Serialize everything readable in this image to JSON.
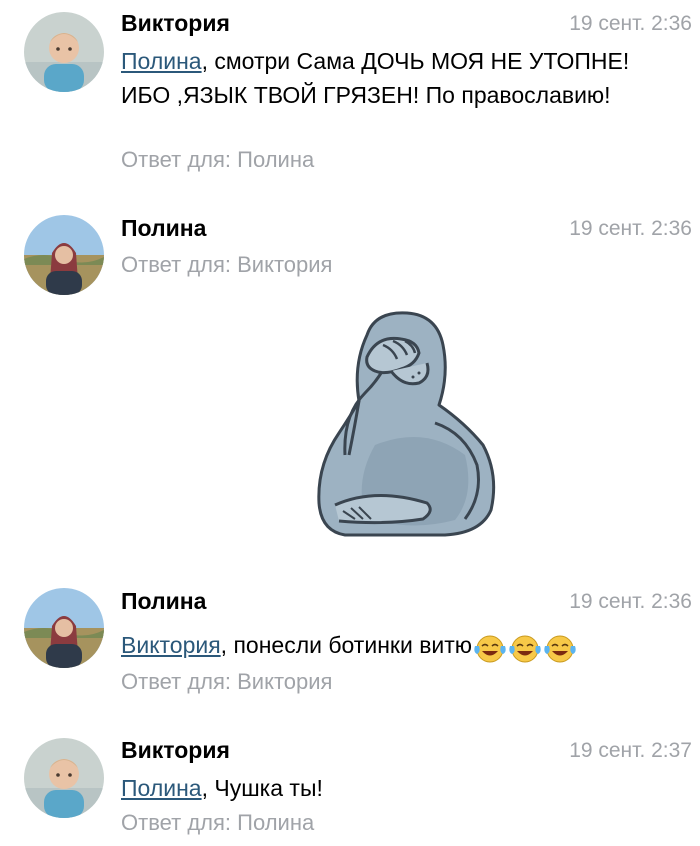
{
  "comments": [
    {
      "author": "Виктория",
      "date": "19 сент. 2:36",
      "mention": "Полина",
      "text": ", смотри  Сама ДОЧЬ МОЯ НЕ УТОПНЕ! ИБО ,ЯЗЫК ТВОЙ ГРЯЗЕН!  По православию!",
      "reply": "Ответ для: Полина"
    },
    {
      "author": "Полина",
      "date": "19 сент. 2:36",
      "reply": "Ответ для: Виктория",
      "sticker": "facepalm-seal-sticker"
    },
    {
      "author": "Полина",
      "date": "19 сент. 2:36",
      "mention": "Виктория",
      "text": ", понесли ботинки витю",
      "emoji": [
        "tears-of-joy",
        "tears-of-joy",
        "tears-of-joy"
      ],
      "reply": "Ответ для: Виктория"
    },
    {
      "author": "Виктория",
      "date": "19 сент. 2:37",
      "mention": "Полина",
      "text": ", Чушка ты!",
      "reply": "Ответ для: Полина"
    }
  ],
  "colors": {
    "link": "#2b587a",
    "meta": "#a0a3a8",
    "sticker_body": "#9db2c2",
    "sticker_outline": "#3a4550"
  }
}
